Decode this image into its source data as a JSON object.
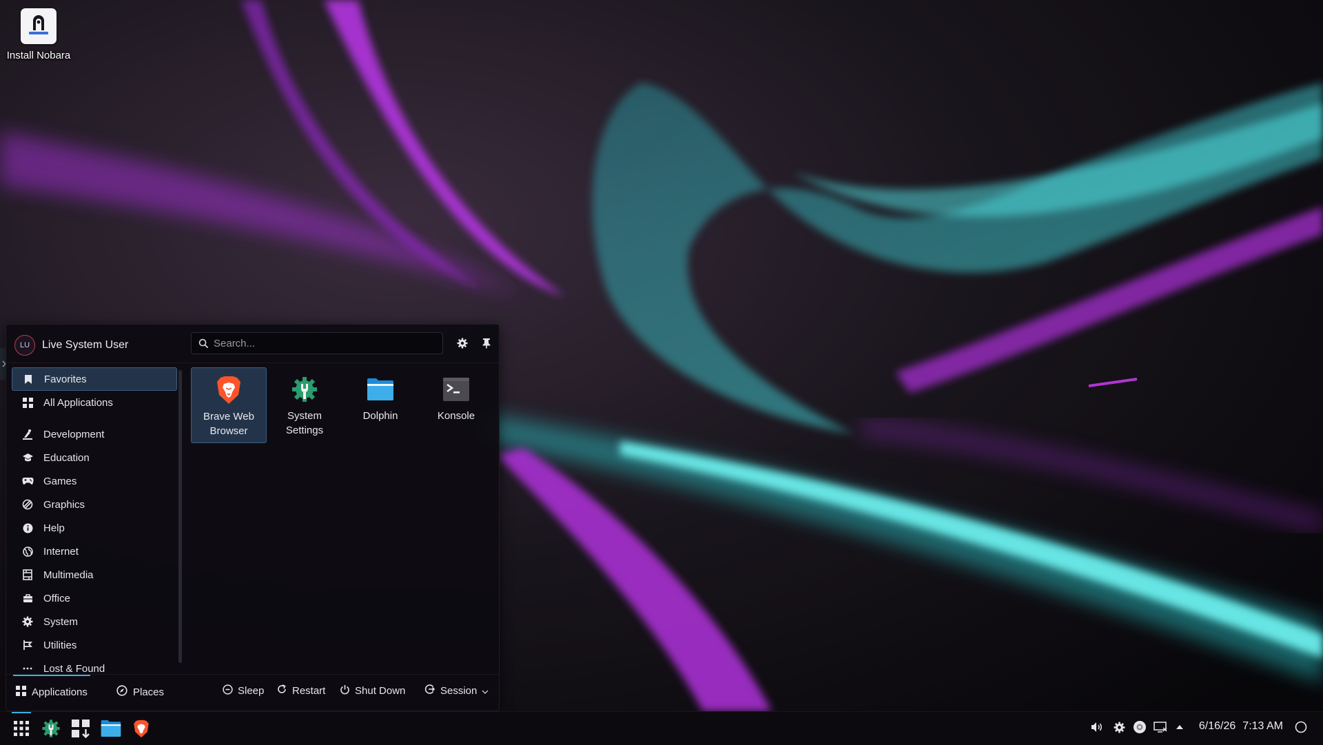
{
  "desktop": {
    "icons": [
      {
        "label": "Install Nobara",
        "icon": "installer-icon"
      }
    ]
  },
  "launcher": {
    "user": {
      "initials": "LU",
      "name": "Live System User"
    },
    "search": {
      "placeholder": "Search..."
    },
    "header_buttons": [
      "settings-icon",
      "pin-icon"
    ],
    "categories": [
      {
        "label": "Favorites",
        "icon": "bookmark-icon",
        "selected": true
      },
      {
        "label": "All Applications",
        "icon": "grid-icon"
      },
      {
        "label": "Development",
        "icon": "development-icon"
      },
      {
        "label": "Education",
        "icon": "education-icon"
      },
      {
        "label": "Games",
        "icon": "gamepad-icon"
      },
      {
        "label": "Graphics",
        "icon": "graphics-icon"
      },
      {
        "label": "Help",
        "icon": "help-icon"
      },
      {
        "label": "Internet",
        "icon": "globe-icon"
      },
      {
        "label": "Multimedia",
        "icon": "multimedia-icon"
      },
      {
        "label": "Office",
        "icon": "office-icon"
      },
      {
        "label": "System",
        "icon": "system-gear-icon"
      },
      {
        "label": "Utilities",
        "icon": "utilities-icon"
      },
      {
        "label": "Lost & Found",
        "icon": "ellipsis-icon"
      }
    ],
    "favorites": [
      {
        "label": "Brave Web Browser",
        "icon": "brave-browser-icon",
        "selected": true
      },
      {
        "label": "System Settings",
        "icon": "system-settings-icon"
      },
      {
        "label": "Dolphin",
        "icon": "dolphin-folder-icon"
      },
      {
        "label": "Konsole",
        "icon": "konsole-terminal-icon"
      }
    ],
    "footer": {
      "tabs": [
        {
          "label": "Applications",
          "icon": "grid-icon",
          "active": true
        },
        {
          "label": "Places",
          "icon": "compass-icon"
        }
      ],
      "power": [
        {
          "label": "Sleep",
          "icon": "sleep-icon"
        },
        {
          "label": "Restart",
          "icon": "restart-icon"
        },
        {
          "label": "Shut Down",
          "icon": "power-icon"
        },
        {
          "label": "Session",
          "icon": "session-icon"
        }
      ]
    }
  },
  "taskbar": {
    "launchers": [
      "app-launcher-icon",
      "system-settings-icon",
      "discover-icon",
      "dolphin-folder-icon",
      "brave-browser-icon"
    ],
    "tray": [
      "volume-icon",
      "settings-icon",
      "media-icon",
      "display-icon",
      "expand-tray-icon"
    ],
    "date": "6/16/26",
    "time": "7:13 AM"
  },
  "colors": {
    "accent": "#3daee9",
    "selection": "#23344a",
    "brave": "#fb542b",
    "wall_teal": "#39e0e0",
    "wall_purple": "#b12fd8"
  }
}
